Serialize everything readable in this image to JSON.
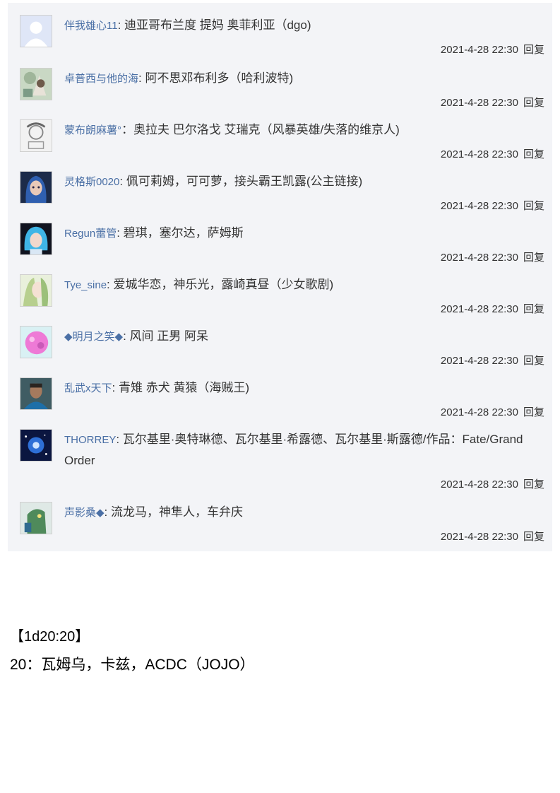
{
  "comments": [
    {
      "user": "伴我雄心11",
      "sep": ": ",
      "text": "迪亚哥布兰度 提妈 奥菲利亚（dgo)",
      "date": "2021-4-28 22:30",
      "reply": "回复",
      "avatar": "default-avatar"
    },
    {
      "user": "卓普西与他的海",
      "sep": ": ",
      "text": "阿不思邓布利多（哈利波特)",
      "date": "2021-4-28 22:30",
      "reply": "回复",
      "avatar": "anime-avatar"
    },
    {
      "user": "蒙布朗麻薯°",
      "sep": "：",
      "text": "奥拉夫 巴尔洛戈 艾瑞克（风暴英雄/失落的维京人)",
      "date": "2021-4-28 22:30",
      "reply": "回复",
      "avatar": "sketch-avatar"
    },
    {
      "user": "灵格斯0020",
      "sep": ": ",
      "text": "佩可莉姆，可可萝，接头霸王凯露(公主链接)",
      "date": "2021-4-28 22:30",
      "reply": "回复",
      "avatar": "blue-hair-avatar"
    },
    {
      "user": "Regun蕾管",
      "sep": ": ",
      "text": "碧琪，塞尔达，萨姆斯",
      "date": "2021-4-28 22:30",
      "reply": "回复",
      "avatar": "cyan-hair-avatar"
    },
    {
      "user": "Tye_sine",
      "sep": ": ",
      "text": "爱城华恋，神乐光，露崎真昼（少女歌剧)",
      "date": "2021-4-28 22:30",
      "reply": "回复",
      "avatar": "green-anime-avatar"
    },
    {
      "user": "◆明月之笑◆",
      "sep": ": ",
      "text": "风间 正男 阿呆",
      "date": "2021-4-28 22:30",
      "reply": "回复",
      "avatar": "pink-blob-avatar"
    },
    {
      "user": "乱武x天下",
      "sep": ": ",
      "text": "青雉 赤犬 黄猿（海贼王)",
      "date": "2021-4-28 22:30",
      "reply": "回复",
      "avatar": "person-avatar"
    },
    {
      "user": "THORREY",
      "sep": ": ",
      "text": "瓦尔基里·奥特琳德、瓦尔基里·希露德、瓦尔基里·斯露德/作品：Fate/Grand Order",
      "date": "2021-4-28 22:30",
      "reply": "回复",
      "avatar": "space-avatar"
    },
    {
      "user": "声影桑◆",
      "sep": ": ",
      "text": "流龙马，神隼人，车弁庆",
      "date": "2021-4-28 22:30",
      "reply": "回复",
      "avatar": "green-robot-avatar"
    }
  ],
  "post": {
    "heading": "【1d20:20】",
    "body": "20：瓦姆乌，卡兹，ACDC（JOJO）"
  }
}
